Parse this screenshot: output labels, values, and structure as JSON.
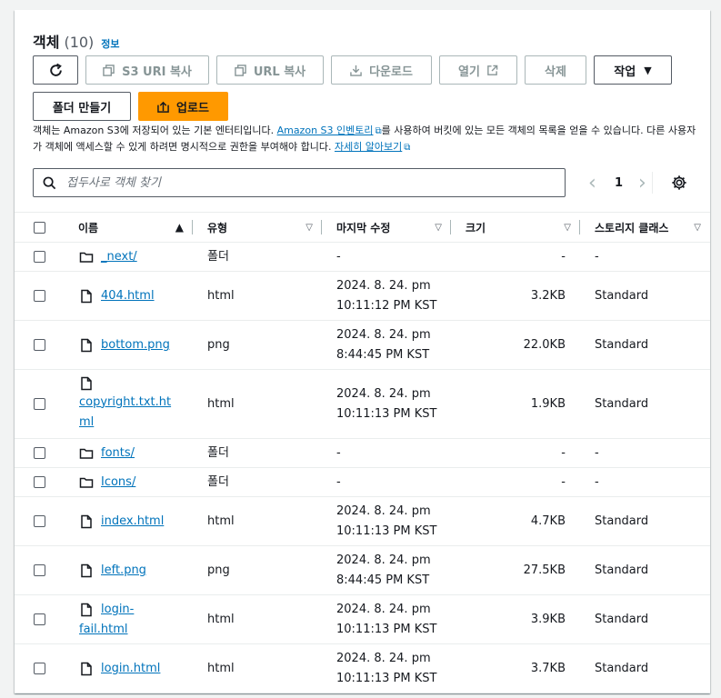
{
  "header": {
    "title": "객체",
    "count": "(10)",
    "info_link": "정보"
  },
  "toolbar": {
    "refresh_icon": "refresh-icon",
    "copy_s3_uri": "S3 URI 복사",
    "copy_url": "URL 복사",
    "download": "다운로드",
    "open": "열기",
    "delete": "삭제",
    "actions": "작업",
    "create_folder": "폴더 만들기",
    "upload": "업로드"
  },
  "description": {
    "part1": "객체는 Amazon S3에 저장되어 있는 기본 엔터티입니다. ",
    "inventory_link": "Amazon S3 인벤토리",
    "part2": "를 사용하여 버킷에 있는 모든 객체의 목록을 얻을 수 있습니다. 다른 사용자가 객체에 액세스할 수 있게 하려면 명시적으로 권한을 부여해야 합니다. ",
    "learn_more_link": "자세히 알아보기"
  },
  "search": {
    "placeholder": "접두사로 객체 찾기",
    "value": ""
  },
  "pagination": {
    "current_page": "1",
    "prev": "‹",
    "next": "›"
  },
  "table": {
    "columns": {
      "name": "이름",
      "type": "유형",
      "last_modified": "마지막 수정",
      "size": "크기",
      "storage_class": "스토리지 클래스"
    },
    "rows": [
      {
        "name": "_next/",
        "kind": "folder",
        "type": "폴더",
        "modified_line1": "-",
        "modified_line2": "",
        "size": "-",
        "storage_class": "-"
      },
      {
        "name": "404.html",
        "kind": "file",
        "type": "html",
        "modified_line1": "2024. 8. 24. pm",
        "modified_line2": "10:11:12 PM KST",
        "size": "3.2KB",
        "storage_class": "Standard"
      },
      {
        "name": "bottom.png",
        "kind": "file",
        "type": "png",
        "modified_line1": "2024. 8. 24. pm",
        "modified_line2": "8:44:45 PM KST",
        "size": "22.0KB",
        "storage_class": "Standard"
      },
      {
        "name_line1": "copyright.txt.ht",
        "name_line2": "ml",
        "kind": "file",
        "type": "html",
        "modified_line1": "2024. 8. 24. pm",
        "modified_line2": "10:11:13 PM KST",
        "size": "1.9KB",
        "storage_class": "Standard"
      },
      {
        "name": "fonts/",
        "kind": "folder",
        "type": "폴더",
        "modified_line1": "-",
        "modified_line2": "",
        "size": "-",
        "storage_class": "-"
      },
      {
        "name": "Icons/",
        "kind": "folder",
        "type": "폴더",
        "modified_line1": "-",
        "modified_line2": "",
        "size": "-",
        "storage_class": "-"
      },
      {
        "name": "index.html",
        "kind": "file",
        "type": "html",
        "modified_line1": "2024. 8. 24. pm",
        "modified_line2": "10:11:13 PM KST",
        "size": "4.7KB",
        "storage_class": "Standard"
      },
      {
        "name": "left.png",
        "kind": "file",
        "type": "png",
        "modified_line1": "2024. 8. 24. pm",
        "modified_line2": "8:44:45 PM KST",
        "size": "27.5KB",
        "storage_class": "Standard"
      },
      {
        "name_line1": "login-",
        "name_line2": "fail.html",
        "kind": "file",
        "type": "html",
        "modified_line1": "2024. 8. 24. pm",
        "modified_line2": "10:11:13 PM KST",
        "size": "3.9KB",
        "storage_class": "Standard"
      },
      {
        "name": "login.html",
        "kind": "file",
        "type": "html",
        "modified_line1": "2024. 8. 24. pm",
        "modified_line2": "10:11:13 PM KST",
        "size": "3.7KB",
        "storage_class": "Standard"
      }
    ]
  },
  "colors": {
    "link": "#0073bb",
    "primary": "#ff9900",
    "border": "#aab7b8",
    "text": "#16191f"
  }
}
